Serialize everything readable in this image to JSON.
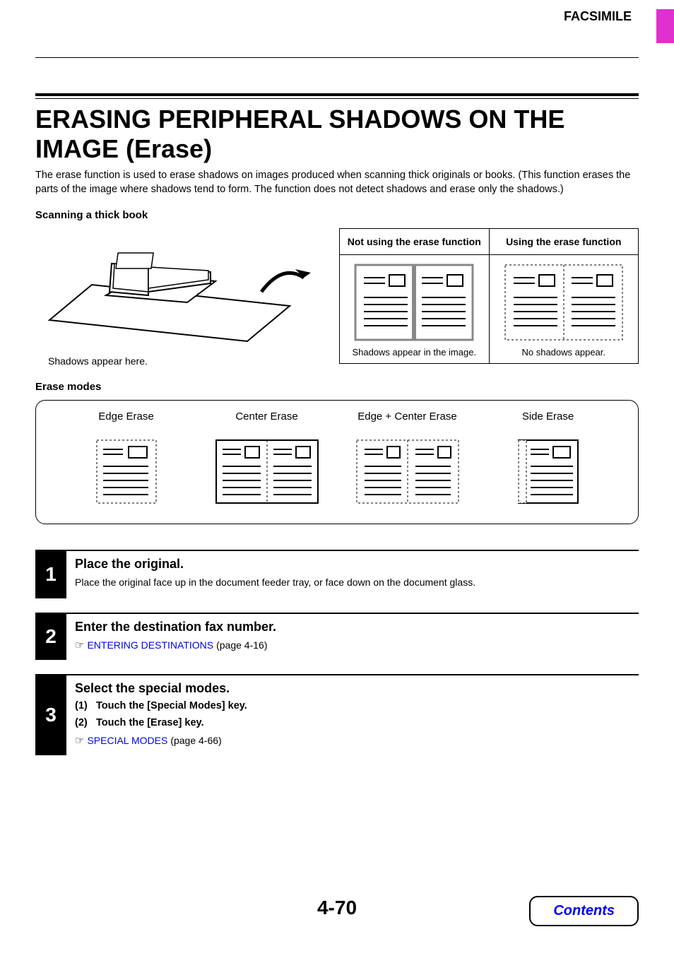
{
  "header": {
    "section": "FACSIMILE"
  },
  "title": "ERASING PERIPHERAL SHADOWS ON THE IMAGE (Erase)",
  "intro": "The erase function is used to erase shadows on images produced when scanning thick originals or books. (This function erases the parts of the image where shadows tend to form. The function does not detect shadows and erase only the shadows.)",
  "scanning": {
    "heading": "Scanning a thick book",
    "caption": "Shadows appear here.",
    "col1_head": "Not using the erase function",
    "col2_head": "Using the erase function",
    "col1_note": "Shadows appear in the image.",
    "col2_note": "No shadows appear."
  },
  "erase_modes": {
    "heading": "Erase modes",
    "items": [
      "Edge Erase",
      "Center Erase",
      "Edge + Center Erase",
      "Side Erase"
    ]
  },
  "steps": [
    {
      "num": "1",
      "title": "Place the original.",
      "text": "Place the original face up in the document feeder tray, or face down on the document glass."
    },
    {
      "num": "2",
      "title": "Enter the destination fax number.",
      "link_text": "ENTERING DESTINATIONS",
      "link_page": " (page 4-16)"
    },
    {
      "num": "3",
      "title": "Select the special modes.",
      "sub1_n": "(1)",
      "sub1_t": "Touch the [Special Modes] key.",
      "sub2_n": "(2)",
      "sub2_t": "Touch the [Erase] key.",
      "link_text": "SPECIAL MODES",
      "link_page": " (page 4-66)"
    }
  ],
  "page_number": "4-70",
  "contents_label": "Contents"
}
